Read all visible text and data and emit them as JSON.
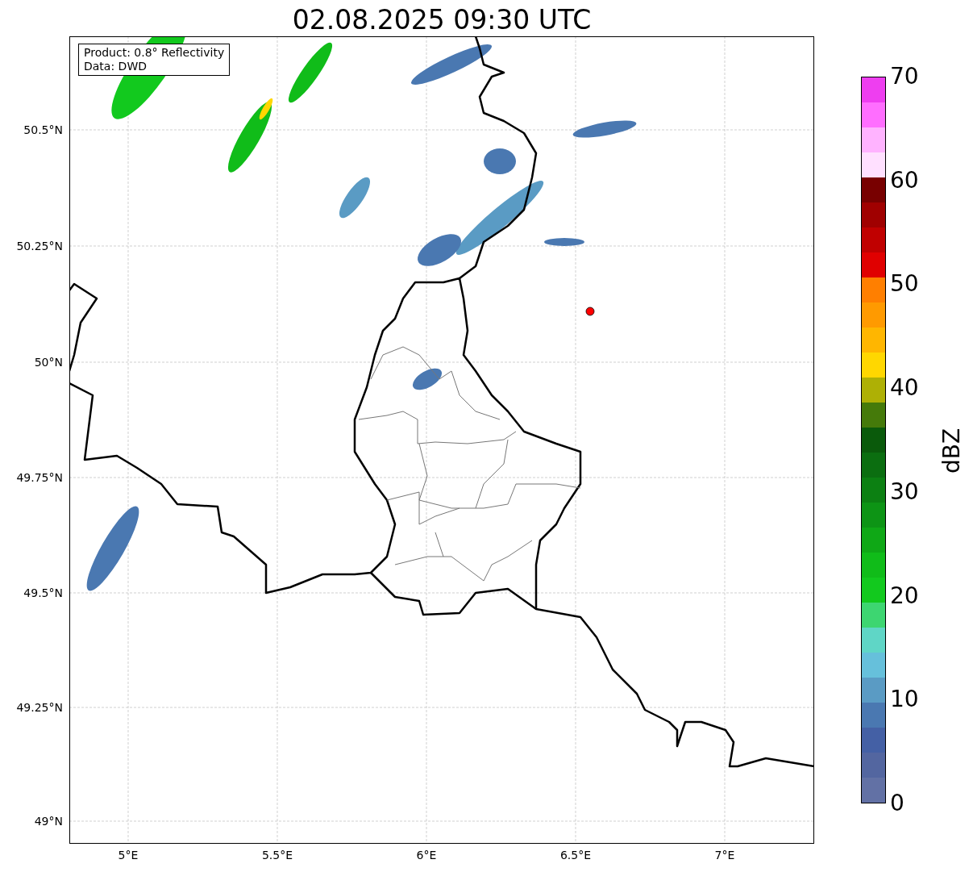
{
  "title": "02.08.2025 09:30 UTC",
  "info_box": [
    "Product: 0.8° Reflectivity",
    "Data: DWD"
  ],
  "y_ticks": [
    "50.5°N",
    "50.25°N",
    "50°N",
    "49.75°N",
    "49.5°N",
    "49.25°N",
    "49°N"
  ],
  "x_ticks": [
    "5°E",
    "5.5°E",
    "6°E",
    "6.5°E",
    "7°E"
  ],
  "colorbar": {
    "label": "dBZ",
    "ticks": [
      "70",
      "60",
      "50",
      "40",
      "30",
      "20",
      "10",
      "0"
    ],
    "bands": [
      {
        "color": "#ee3ef0"
      },
      {
        "color": "#ff6eff"
      },
      {
        "color": "#ffb3ff"
      },
      {
        "color": "#ffe0ff"
      },
      {
        "color": "#780000"
      },
      {
        "color": "#a00000"
      },
      {
        "color": "#c00000"
      },
      {
        "color": "#e00000"
      },
      {
        "color": "#ff7f00"
      },
      {
        "color": "#ff9a00"
      },
      {
        "color": "#ffb600"
      },
      {
        "color": "#ffd700"
      },
      {
        "color": "#aeb005"
      },
      {
        "color": "#457a0a"
      },
      {
        "color": "#0a5a0b"
      },
      {
        "color": "#0b6e10"
      },
      {
        "color": "#0c8012"
      },
      {
        "color": "#0d9415"
      },
      {
        "color": "#0fa816"
      },
      {
        "color": "#10bc19"
      },
      {
        "color": "#12c91e"
      },
      {
        "color": "#3dd671"
      },
      {
        "color": "#5fd6c6"
      },
      {
        "color": "#66c0db"
      },
      {
        "color": "#5a9bc4"
      },
      {
        "color": "#4a78b1"
      },
      {
        "color": "#4460a5"
      },
      {
        "color": "#5366a0"
      },
      {
        "color": "#6271a5"
      }
    ]
  }
}
